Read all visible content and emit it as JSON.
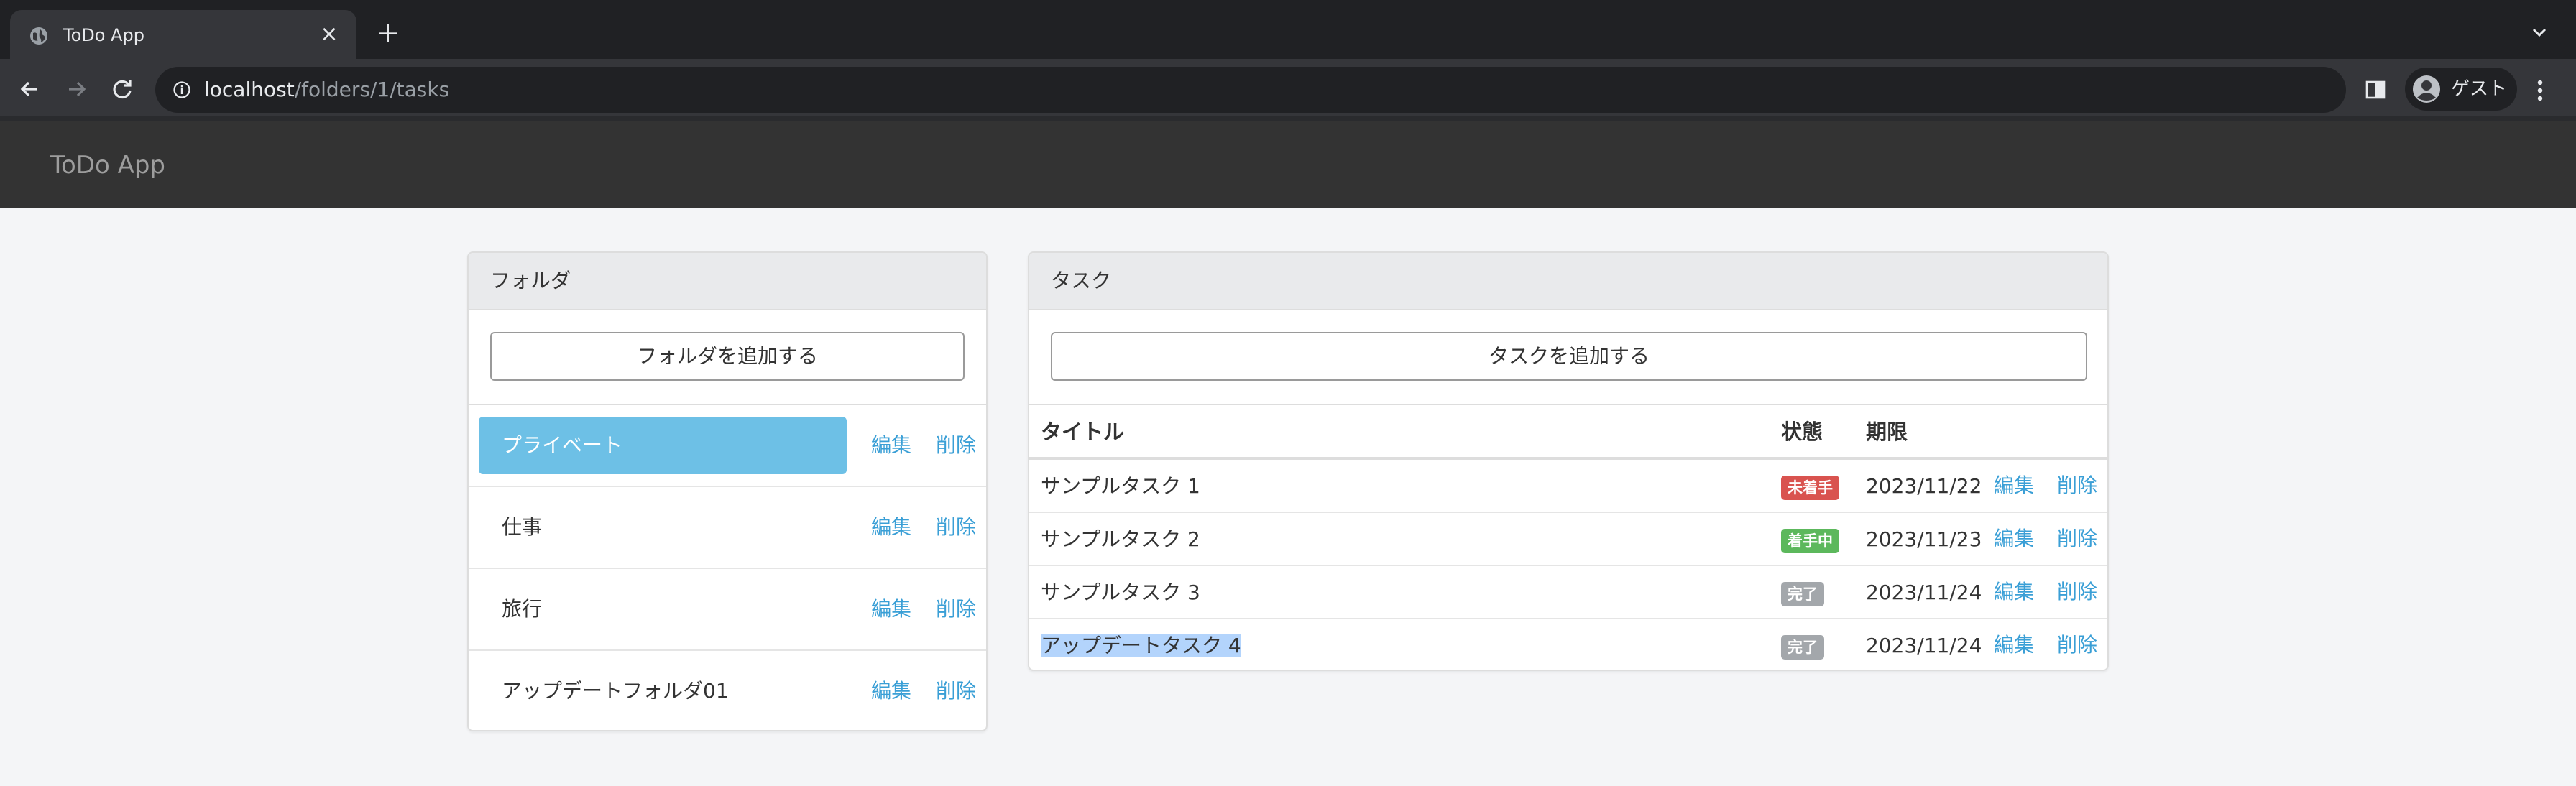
{
  "browser": {
    "tab_title": "ToDo App",
    "url_host": "localhost",
    "url_path": "/folders/1/tasks",
    "profile_label": "ゲスト"
  },
  "app": {
    "brand": "ToDo App"
  },
  "folders": {
    "heading": "フォルダ",
    "add_button": "フォルダを追加する",
    "items": [
      {
        "name": "プライベート",
        "active": true,
        "edit": "編集",
        "delete": "削除"
      },
      {
        "name": "仕事",
        "active": false,
        "edit": "編集",
        "delete": "削除"
      },
      {
        "name": "旅行",
        "active": false,
        "edit": "編集",
        "delete": "削除"
      },
      {
        "name": "アップデートフォルダ01",
        "active": false,
        "edit": "編集",
        "delete": "削除"
      }
    ]
  },
  "tasks": {
    "heading": "タスク",
    "add_button": "タスクを追加する",
    "columns": {
      "title": "タイトル",
      "status": "状態",
      "due": "期限"
    },
    "rows": [
      {
        "title": "サンプルタスク 1",
        "status": "未着手",
        "status_color": "#d9534f",
        "due": "2023/11/22",
        "edit": "編集",
        "delete": "削除"
      },
      {
        "title": "サンプルタスク 2",
        "status": "着手中",
        "status_color": "#5cb85c",
        "due": "2023/11/23",
        "edit": "編集",
        "delete": "削除"
      },
      {
        "title": "サンプルタスク 3",
        "status": "完了",
        "status_color": "#a3a7ab",
        "due": "2023/11/24",
        "edit": "編集",
        "delete": "削除"
      },
      {
        "title": "アップデートタスク 4",
        "status": "完了",
        "status_color": "#a3a7ab",
        "due": "2023/11/24",
        "edit": "編集",
        "delete": "削除",
        "selected": true
      }
    ]
  },
  "colors": {
    "link": "#3a9fd6",
    "active_folder": "#6dc0e6",
    "navbar": "#333333"
  }
}
